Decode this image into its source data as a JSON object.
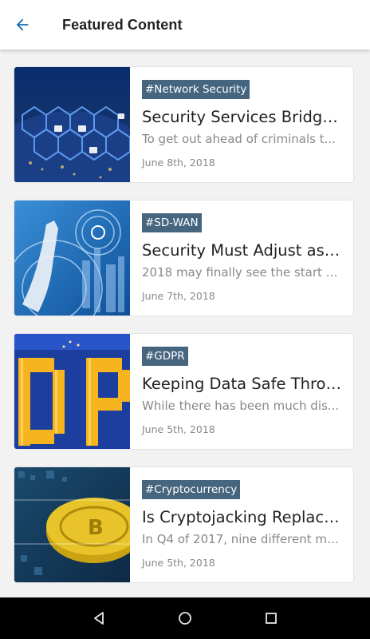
{
  "header": {
    "title": "Featured Content"
  },
  "articles": [
    {
      "tag": "#Network Security",
      "title": "Security Services Bridge the Gap",
      "description": "To get out ahead of criminals t...",
      "date": "June 8th, 2018"
    },
    {
      "tag": "#SD-WAN",
      "title": "Security Must Adjust as SD-WAN",
      "description": "2018 may finally see the start o...",
      "date": "June 7th, 2018"
    },
    {
      "tag": "#GDPR",
      "title": "Keeping Data Safe Through GDPR",
      "description": "While there has been much dis...",
      "date": "June 5th, 2018"
    },
    {
      "tag": "#Cryptocurrency",
      "title": "Is Cryptojacking Replacing Ransomware",
      "description": "In Q4 of 2017, nine different ma...",
      "date": "June 5th, 2018"
    }
  ],
  "colors": {
    "accent": "#1a6fb6",
    "tag_bg": "#46657e"
  },
  "icons": {
    "back": "arrow-left-icon",
    "nav_back": "triangle-back-icon",
    "nav_home": "circle-home-icon",
    "nav_recent": "square-recents-icon"
  }
}
